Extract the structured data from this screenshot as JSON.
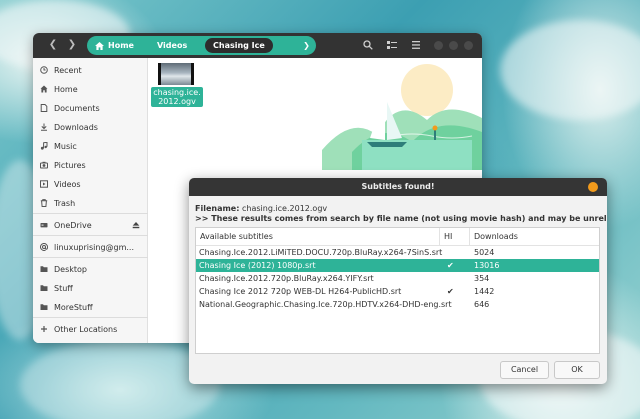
{
  "file_manager": {
    "breadcrumbs": [
      "Home",
      "Videos",
      "Chasing Ice"
    ],
    "sidebar": {
      "places": [
        {
          "label": "Recent",
          "icon": "clock-icon"
        },
        {
          "label": "Home",
          "icon": "home-icon"
        },
        {
          "label": "Documents",
          "icon": "document-icon"
        },
        {
          "label": "Downloads",
          "icon": "download-icon"
        },
        {
          "label": "Music",
          "icon": "music-icon"
        },
        {
          "label": "Pictures",
          "icon": "camera-icon"
        },
        {
          "label": "Videos",
          "icon": "video-icon"
        },
        {
          "label": "Trash",
          "icon": "trash-icon"
        }
      ],
      "devices": [
        {
          "label": "OneDrive",
          "icon": "drive-icon"
        }
      ],
      "network": [
        {
          "label": "linuxuprising@gm...",
          "icon": "at-icon"
        }
      ],
      "bookmarks": [
        {
          "label": "Desktop",
          "icon": "folder-icon"
        },
        {
          "label": "Stuff",
          "icon": "folder-icon"
        },
        {
          "label": "MoreStuff",
          "icon": "folder-icon"
        }
      ],
      "other": {
        "label": "Other Locations",
        "icon": "plus-icon"
      }
    },
    "files": [
      {
        "name": "chasing.ice.2012.ogv"
      }
    ],
    "file_label_line1": "chasing.ice.",
    "file_label_line2": "2012.ogv"
  },
  "dialog": {
    "title": "Subtitles found!",
    "filename_label": "Filename:",
    "filename_value": "chasing.ice.2012.ogv",
    "note": ">> These results comes from search by file name (not using movie hash) and may be unreliable...",
    "columns": [
      "Available subtitles",
      "HI",
      "Downloads"
    ],
    "rows": [
      {
        "name": "Chasing.Ice.2012.LiMiTED.DOCU.720p.BluRay.x264-7SinS.srt",
        "hi": "",
        "downloads": "5024"
      },
      {
        "name": "Chasing Ice (2012) 1080p.srt",
        "hi": "✔",
        "downloads": "13016"
      },
      {
        "name": "Chasing.Ice.2012.720p.BluRay.x264.YIFY.srt",
        "hi": "",
        "downloads": "354"
      },
      {
        "name": "Chasing Ice 2012 720p WEB-DL H264-PublicHD.srt",
        "hi": "✔",
        "downloads": "1442"
      },
      {
        "name": "National.Geographic.Chasing.Ice.720p.HDTV.x264-DHD-eng.srt",
        "hi": "",
        "downloads": "646"
      }
    ],
    "selected_row": 1,
    "cancel_label": "Cancel",
    "ok_label": "OK"
  },
  "colors": {
    "accent": "#2eb398",
    "header": "#333333",
    "close_button": "#f29b1c"
  }
}
